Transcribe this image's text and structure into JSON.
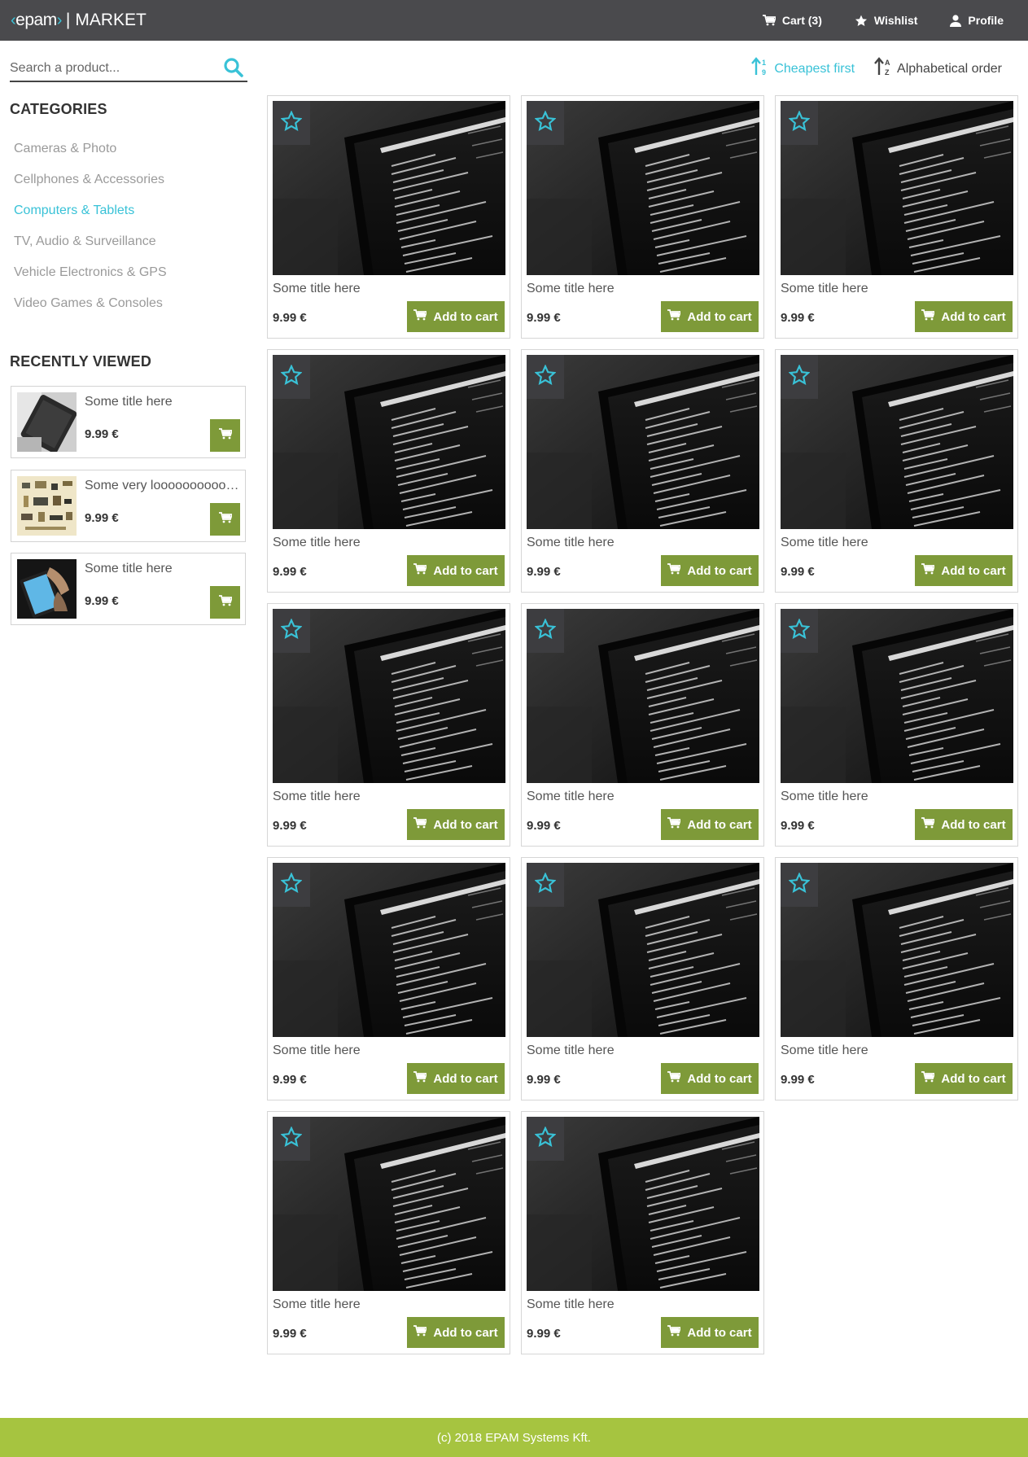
{
  "header": {
    "logo_text": "epam",
    "separator": "|",
    "title": "MARKET",
    "cart_label": "Cart (3)",
    "wishlist_label": "Wishlist",
    "profile_label": "Profile"
  },
  "search": {
    "placeholder": "Search a product..."
  },
  "sidebar": {
    "categories_heading": "CATEGORIES",
    "categories": [
      {
        "label": "Cameras & Photo",
        "active": false
      },
      {
        "label": "Cellphones & Accessories",
        "active": false
      },
      {
        "label": "Computers & Tablets",
        "active": true
      },
      {
        "label": "TV, Audio & Surveillance",
        "active": false
      },
      {
        "label": "Vehicle Electronics & GPS",
        "active": false
      },
      {
        "label": "Video Games & Consoles",
        "active": false
      }
    ],
    "recent_heading": "RECENTLY VIEWED",
    "recent": [
      {
        "title": "Some title here",
        "price": "9.99 €",
        "thumb": "tablet-on-desk"
      },
      {
        "title": "Some very loooooooooooooong title here",
        "price": "9.99 €",
        "thumb": "electronic-components"
      },
      {
        "title": "Some title here",
        "price": "9.99 €",
        "thumb": "hand-holding-tablet"
      }
    ]
  },
  "sort": {
    "cheapest_label": "Cheapest first",
    "alpha_label": "Alphabetical order",
    "active": "cheapest"
  },
  "products": [
    {
      "title": "Some title here",
      "price": "9.99 €",
      "button": "Add to cart"
    },
    {
      "title": "Some title here",
      "price": "9.99 €",
      "button": "Add to cart"
    },
    {
      "title": "Some title here",
      "price": "9.99 €",
      "button": "Add to cart"
    },
    {
      "title": "Some title here",
      "price": "9.99 €",
      "button": "Add to cart"
    },
    {
      "title": "Some title here",
      "price": "9.99 €",
      "button": "Add to cart"
    },
    {
      "title": "Some title here",
      "price": "9.99 €",
      "button": "Add to cart"
    },
    {
      "title": "Some title here",
      "price": "9.99 €",
      "button": "Add to cart"
    },
    {
      "title": "Some title here",
      "price": "9.99 €",
      "button": "Add to cart"
    },
    {
      "title": "Some title here",
      "price": "9.99 €",
      "button": "Add to cart"
    },
    {
      "title": "Some title here",
      "price": "9.99 €",
      "button": "Add to cart"
    },
    {
      "title": "Some title here",
      "price": "9.99 €",
      "button": "Add to cart"
    },
    {
      "title": "Some title here",
      "price": "9.99 €",
      "button": "Add to cart"
    },
    {
      "title": "Some title here",
      "price": "9.99 €",
      "button": "Add to cart"
    },
    {
      "title": "Some title here",
      "price": "9.99 €",
      "button": "Add to cart"
    }
  ],
  "footer": {
    "text": "(c) 2018 EPAM Systems Kft."
  },
  "colors": {
    "header_bg": "#4a4a4d",
    "accent": "#39c2d7",
    "button_green": "#7e9a39",
    "footer_green": "#a6c440"
  }
}
